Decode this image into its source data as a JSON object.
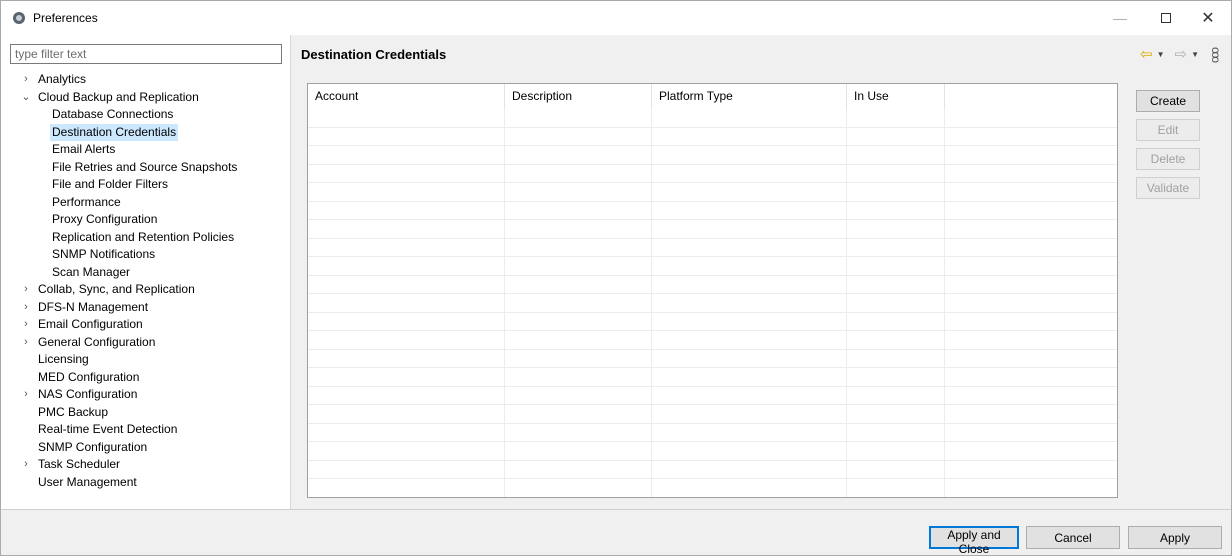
{
  "window": {
    "title": "Preferences",
    "minimize": "—",
    "close": "✕"
  },
  "filter": {
    "placeholder": "type filter text",
    "value": ""
  },
  "tree": [
    {
      "label": "Analytics",
      "toggle": "›",
      "level": 0,
      "selected": false
    },
    {
      "label": "Cloud Backup and Replication",
      "toggle": "⌄",
      "level": 0,
      "selected": false
    },
    {
      "label": "Database Connections",
      "toggle": "",
      "level": 1,
      "selected": false
    },
    {
      "label": "Destination Credentials",
      "toggle": "",
      "level": 1,
      "selected": true
    },
    {
      "label": "Email Alerts",
      "toggle": "",
      "level": 1,
      "selected": false
    },
    {
      "label": "File Retries and Source Snapshots",
      "toggle": "",
      "level": 1,
      "selected": false
    },
    {
      "label": "File and Folder Filters",
      "toggle": "",
      "level": 1,
      "selected": false
    },
    {
      "label": "Performance",
      "toggle": "",
      "level": 1,
      "selected": false
    },
    {
      "label": "Proxy Configuration",
      "toggle": "",
      "level": 1,
      "selected": false
    },
    {
      "label": "Replication and Retention Policies",
      "toggle": "",
      "level": 1,
      "selected": false
    },
    {
      "label": "SNMP Notifications",
      "toggle": "",
      "level": 1,
      "selected": false
    },
    {
      "label": "Scan Manager",
      "toggle": "",
      "level": 1,
      "selected": false
    },
    {
      "label": "Collab, Sync, and Replication",
      "toggle": "›",
      "level": 0,
      "selected": false
    },
    {
      "label": "DFS-N Management",
      "toggle": "›",
      "level": 0,
      "selected": false
    },
    {
      "label": "Email Configuration",
      "toggle": "›",
      "level": 0,
      "selected": false
    },
    {
      "label": "General Configuration",
      "toggle": "›",
      "level": 0,
      "selected": false
    },
    {
      "label": "Licensing",
      "toggle": "",
      "level": 0,
      "selected": false
    },
    {
      "label": "MED Configuration",
      "toggle": "",
      "level": 0,
      "selected": false
    },
    {
      "label": "NAS Configuration",
      "toggle": "›",
      "level": 0,
      "selected": false
    },
    {
      "label": "PMC Backup",
      "toggle": "",
      "level": 0,
      "selected": false
    },
    {
      "label": "Real-time Event Detection",
      "toggle": "",
      "level": 0,
      "selected": false
    },
    {
      "label": "SNMP Configuration",
      "toggle": "",
      "level": 0,
      "selected": false
    },
    {
      "label": "Task Scheduler",
      "toggle": "›",
      "level": 0,
      "selected": false
    },
    {
      "label": "User Management",
      "toggle": "",
      "level": 0,
      "selected": false
    }
  ],
  "page": {
    "title": "Destination Credentials",
    "nav": {
      "back": "⇦",
      "forward": "⇨",
      "dropdown": "▼",
      "menu": "ooo"
    }
  },
  "table": {
    "columns": [
      "Account",
      "Description",
      "Platform Type",
      "In Use",
      ""
    ],
    "rows": []
  },
  "side_buttons": [
    {
      "label": "Create",
      "enabled": true
    },
    {
      "label": "Edit",
      "enabled": false
    },
    {
      "label": "Delete",
      "enabled": false
    },
    {
      "label": "Validate",
      "enabled": false
    }
  ],
  "footer": {
    "apply_close": "Apply and Close",
    "cancel": "Cancel",
    "apply": "Apply"
  },
  "colors": {
    "selection": "#cce8ff",
    "primary_border": "#0078d7",
    "back_arrow": "#e0a800"
  }
}
